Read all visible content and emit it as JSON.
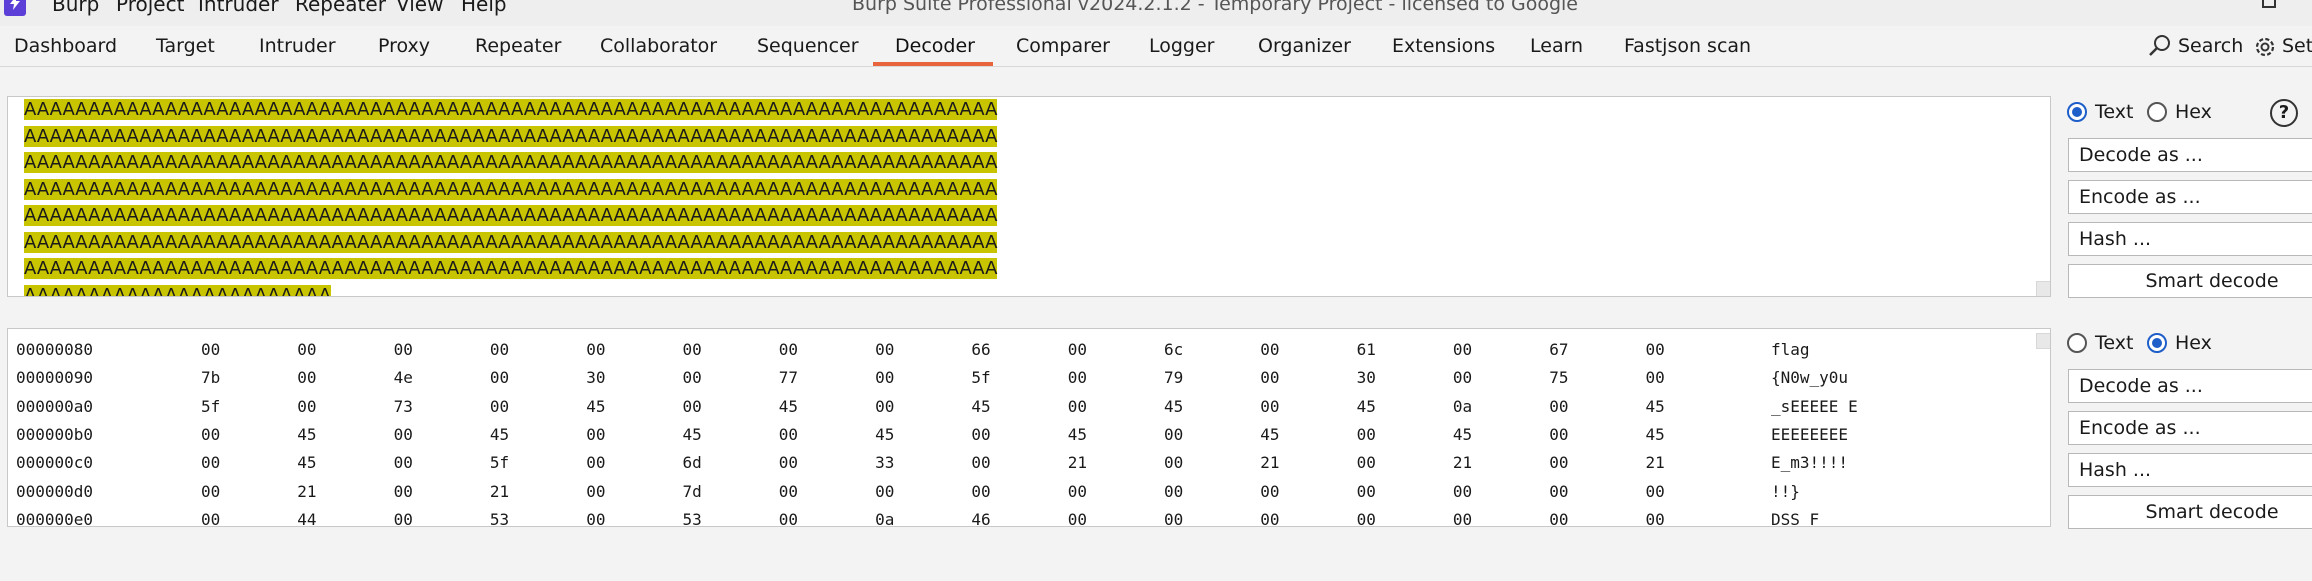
{
  "app": {
    "title": "Burp Suite Professional v2024.2.1.2 - Temporary Project - licensed to Google",
    "menu": [
      "Burp",
      "Project",
      "Intruder",
      "Repeater",
      "View",
      "Help"
    ]
  },
  "tabs": [
    "Dashboard",
    "Target",
    "Intruder",
    "Proxy",
    "Repeater",
    "Collaborator",
    "Sequencer",
    "Decoder",
    "Comparer",
    "Logger",
    "Organizer",
    "Extensions",
    "Learn",
    "Fastjson scan"
  ],
  "active_tab": "Decoder",
  "toolbar": {
    "search_label": "Search",
    "settings_label": "Set"
  },
  "decoder": {
    "input_lines": [
      "AAAAAAAAAAAAAAAAAAAAAAAAAAAAAAAAAAAAAAAAAAAAAAAAAAAAAAAAAAAAAAAAAAAAAAAAAAAA",
      "AAAAAAAAAAAAAAAAAAAAAAAAAAAAAAAAAAAAAAAAAAAAAAAAAAAAAAAAAAAAAAAAAAAAAAAAAAAA",
      "AAAAAAAAAAAAAAAAAAAAAAAAAAAAAAAAAAAAAAAAAAAAAAAAAAAAAAAAAAAAAAAAAAAAAAAAAAAA",
      "AAAAAAAAAAAAAAAAAAAAAAAAAAAAAAAAAAAAAAAAAAAAAAAAAAAAAAAAAAAAAAAAAAAAAAAAAAAA",
      "AAAAAAAAAAAAAAAAAAAAAAAAAAAAAAAAAAAAAAAAAAAAAAAAAAAAAAAAAAAAAAAAAAAAAAAAAAAA",
      "AAAAAAAAAAAAAAAAAAAAAAAAAAAAAAAAAAAAAAAAAAAAAAAAAAAAAAAAAAAAAAAAAAAAAAAAAAAA",
      "AAAAAAAAAAAAAAAAAAAAAAAAAAAAAAAAAAAAAAAAAAAAAAAAAAAAAAAAAAAAAAAAAAAAAAAAAAAA",
      "AAAAAAAAAAAAAAAAAAAAAAAA"
    ],
    "hex_rows": [
      {
        "offset": "00000080",
        "bytes": [
          "00",
          "00",
          "00",
          "00",
          "00",
          "00",
          "00",
          "00",
          "66",
          "00",
          "6c",
          "00",
          "61",
          "00",
          "67",
          "00"
        ],
        "ascii": "flag"
      },
      {
        "offset": "00000090",
        "bytes": [
          "7b",
          "00",
          "4e",
          "00",
          "30",
          "00",
          "77",
          "00",
          "5f",
          "00",
          "79",
          "00",
          "30",
          "00",
          "75",
          "00"
        ],
        "ascii": "{N0w_y0u"
      },
      {
        "offset": "000000a0",
        "bytes": [
          "5f",
          "00",
          "73",
          "00",
          "45",
          "00",
          "45",
          "00",
          "45",
          "00",
          "45",
          "00",
          "45",
          "0a",
          "00",
          "45"
        ],
        "ascii": "_sEEEEE E"
      },
      {
        "offset": "000000b0",
        "bytes": [
          "00",
          "45",
          "00",
          "45",
          "00",
          "45",
          "00",
          "45",
          "00",
          "45",
          "00",
          "45",
          "00",
          "45",
          "00",
          "45"
        ],
        "ascii": "EEEEEEEE"
      },
      {
        "offset": "000000c0",
        "bytes": [
          "00",
          "45",
          "00",
          "5f",
          "00",
          "6d",
          "00",
          "33",
          "00",
          "21",
          "00",
          "21",
          "00",
          "21",
          "00",
          "21"
        ],
        "ascii": "E_m3!!!!"
      },
      {
        "offset": "000000d0",
        "bytes": [
          "00",
          "21",
          "00",
          "21",
          "00",
          "7d",
          "00",
          "00",
          "00",
          "00",
          "00",
          "00",
          "00",
          "00",
          "00",
          "00"
        ],
        "ascii": "!!}"
      },
      {
        "offset": "000000e0",
        "bytes": [
          "00",
          "44",
          "00",
          "53",
          "00",
          "53",
          "00",
          "0a",
          "46",
          "00",
          "00",
          "00",
          "00",
          "00",
          "00",
          "00"
        ],
        "ascii": "DSS F"
      }
    ],
    "panel1": {
      "text_label": "Text",
      "hex_label": "Hex",
      "selected": "Text",
      "decode_label": "Decode as ...",
      "encode_label": "Encode as ...",
      "hash_label": "Hash ...",
      "smart_label": "Smart decode"
    },
    "panel2": {
      "text_label": "Text",
      "hex_label": "Hex",
      "selected": "Hex",
      "decode_label": "Decode as ...",
      "encode_label": "Encode as ...",
      "hash_label": "Hash ...",
      "smart_label": "Smart decode"
    },
    "help_label": "?"
  }
}
